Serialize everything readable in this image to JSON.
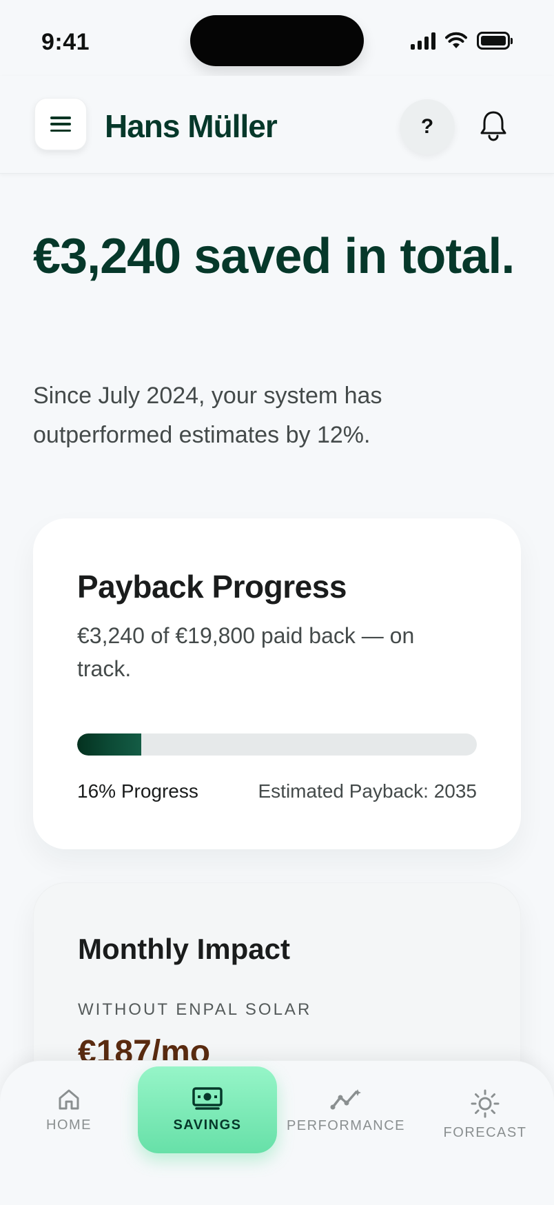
{
  "status_bar": {
    "time": "9:41"
  },
  "header": {
    "user_name": "Hans Müller",
    "help_label": "?"
  },
  "hero": {
    "title": "€3,240 saved in total.",
    "subtitle": "Since July 2024, your system has outperformed estimates by 12%."
  },
  "payback": {
    "title": "Payback Progress",
    "description": "€3,240 of €19,800 paid back — on track.",
    "progress_fraction": 0.16,
    "progress_label": "16% Progress",
    "estimate_label": "Estimated Payback: 2035"
  },
  "monthly": {
    "title": "Monthly Impact",
    "without_label": "WITHOUT ENPAL SOLAR",
    "without_value": "€187/mo"
  },
  "nav": {
    "items": [
      {
        "label": "HOME",
        "icon": "home-icon",
        "active": false
      },
      {
        "label": "SAVINGS",
        "icon": "money-icon",
        "active": true
      },
      {
        "label": "PERFORMANCE",
        "icon": "trend-icon",
        "active": false
      },
      {
        "label": "FORECAST",
        "icon": "sun-icon",
        "active": false
      }
    ]
  },
  "colors": {
    "brand_dark": "#06382a",
    "accent_green": "#67e0a8",
    "progress_fill": "#0c4a35",
    "background": "#f6f8fa"
  }
}
